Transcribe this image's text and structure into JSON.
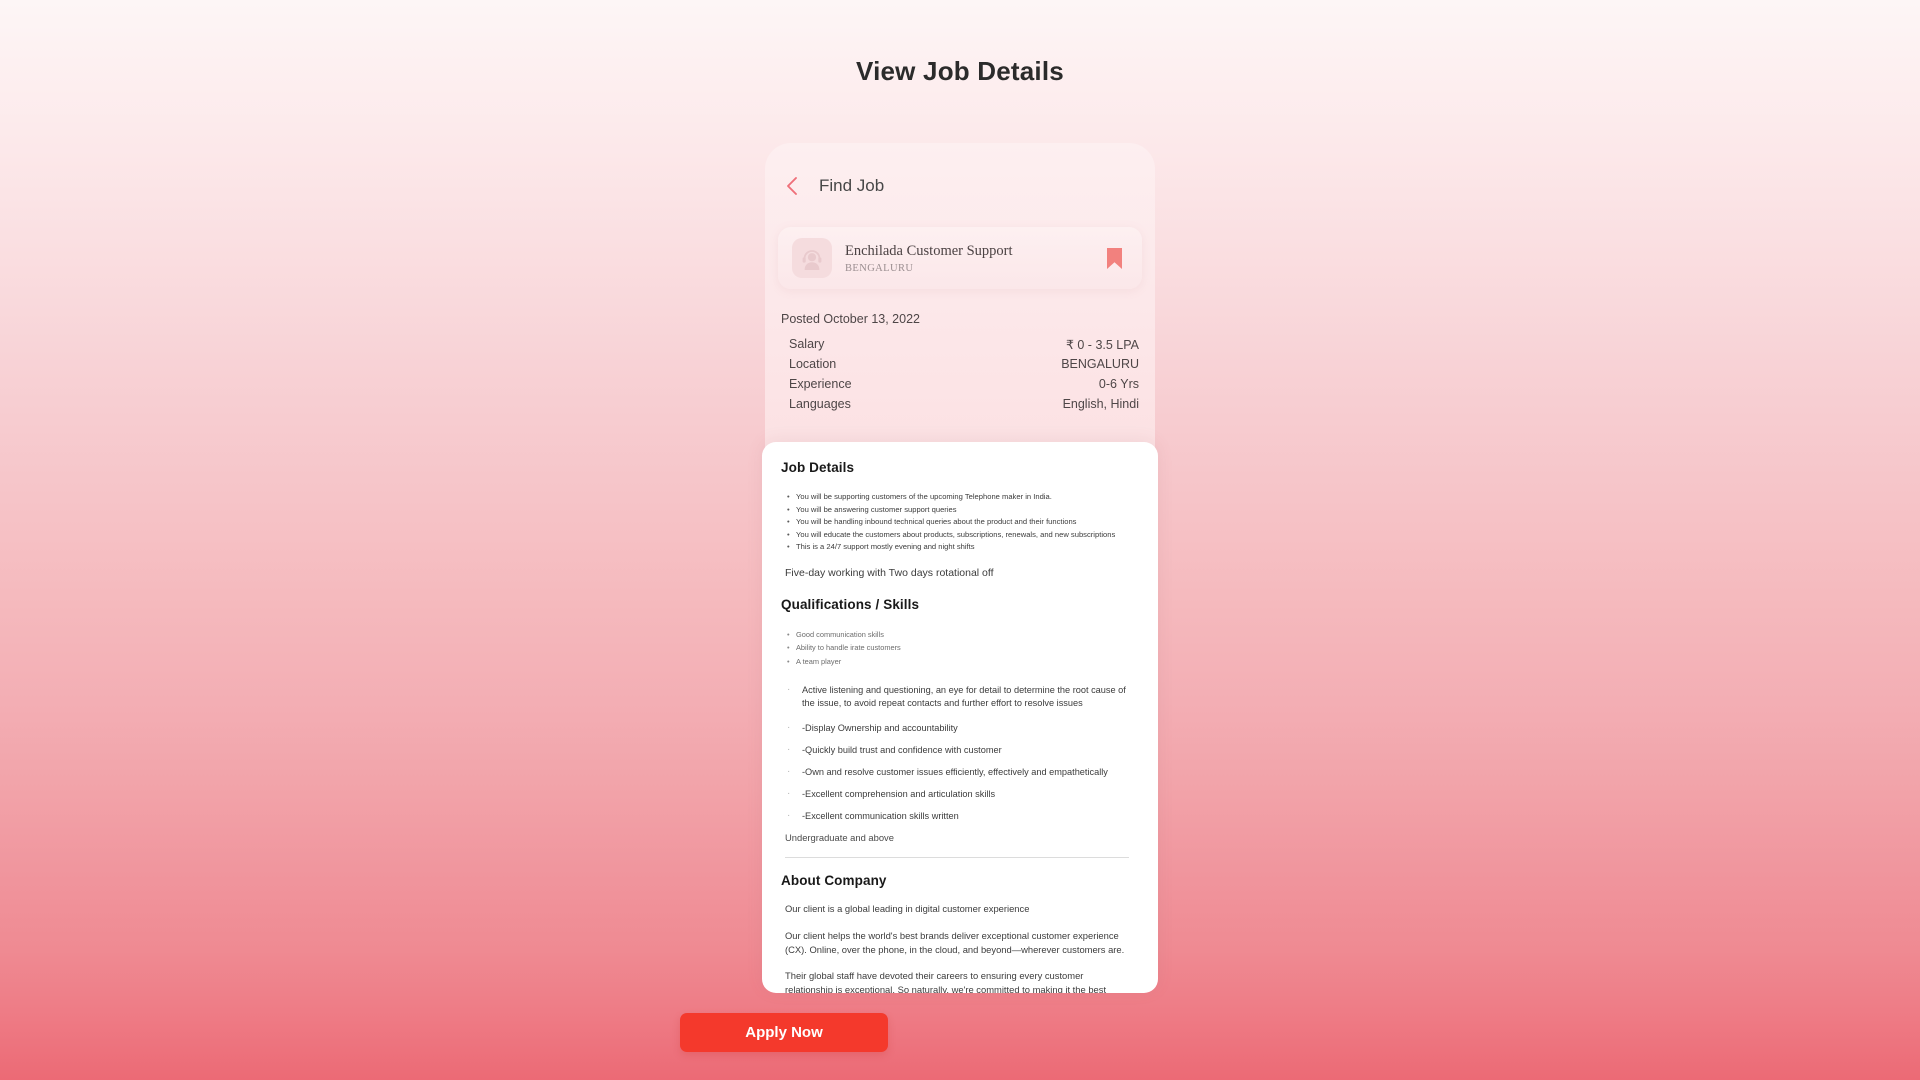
{
  "page": {
    "title": "View Job Details"
  },
  "topbar": {
    "back_icon": "chevron-left-icon",
    "title": "Find Job"
  },
  "job_card": {
    "avatar_icon": "support-agent-avatar-icon",
    "title": "Enchilada Customer Support",
    "location": "BENGALURU",
    "bookmark_icon": "bookmark-icon"
  },
  "info": {
    "posted": "Posted October 13, 2022",
    "rows": [
      {
        "label": "Salary",
        "value": "₹ 0 - 3.5 LPA"
      },
      {
        "label": "Location",
        "value": "BENGALURU"
      },
      {
        "label": "Experience",
        "value": "0-6 Yrs"
      },
      {
        "label": "Languages",
        "value": "English, Hindi"
      }
    ]
  },
  "job_details": {
    "heading": "Job Details",
    "bullets": [
      "You will be supporting customers of the upcoming Telephone maker in India.",
      "You will be answering customer support queries",
      "You will be handling inbound technical queries about the product and their functions",
      "You will educate the customers about products, subscriptions, renewals, and new subscriptions",
      "This is a 24/7 support mostly evening and night shifts"
    ],
    "note": "Five-day working with  Two days rotational off"
  },
  "qualifications": {
    "heading": "Qualifications / Skills",
    "skills": [
      "Good communication skills",
      "Ability to handle irate customers",
      "A team player"
    ],
    "details": [
      "Active listening and questioning, an eye for detail to determine the root cause of the issue, to avoid repeat contacts and further effort to resolve issues",
      "-Display Ownership and accountability",
      "-Quickly build trust and confidence with customer",
      "-Own and resolve customer issues efficiently, effectively and empathetically",
      "-Excellent comprehension and articulation skills",
      "-Excellent communication skills written"
    ],
    "education": "Undergraduate and above"
  },
  "about_company": {
    "heading": "About Company",
    "paragraphs": [
      "Our client is a global leading in digital customer experience",
      "Our client helps the world's best brands deliver exceptional customer experience (CX). Online, over the phone, in the cloud, and beyond—wherever customers are.",
      "Their global staff have devoted their careers to ensuring every customer relationship is exceptional. So naturally, we're committed to making it the best place to grow a career, too."
    ]
  },
  "apply": {
    "label": "Apply Now"
  },
  "colors": {
    "apply_button": "#f4392c",
    "accent_pink": "#f2817e",
    "background_top": "#fdf6f6",
    "background_bottom": "#ec6a75"
  }
}
